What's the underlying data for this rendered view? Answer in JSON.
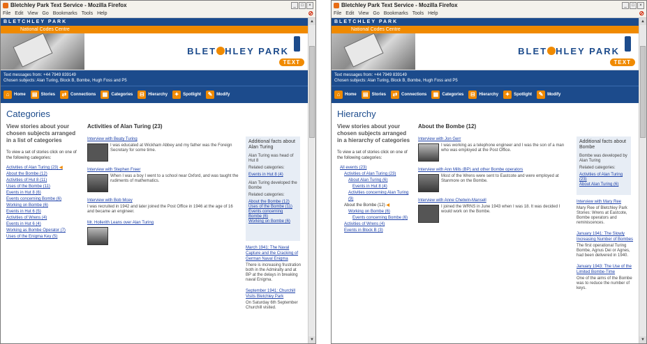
{
  "browser": {
    "title": "Bletchley Park Text Service - Mozilla Firefox",
    "menu": [
      "File",
      "Edit",
      "View",
      "Go",
      "Bookmarks",
      "Tools",
      "Help"
    ]
  },
  "site": {
    "brand": "BLETCHLEY PARK",
    "subbrand": "National Codes Centre",
    "banner_brand_left": "BLET",
    "banner_brand_right": "HLEY PARK",
    "text_tag": "TEXT",
    "info_line1": "Text messages from: +44 7949 839149",
    "info_line2": "Chosen subjects: Alan Turing, Block B, Bombe, Hugh Foss and P5",
    "nav": [
      {
        "label": "Home",
        "icon": "home-icon",
        "glyph": "⌂"
      },
      {
        "label": "Stories",
        "icon": "stories-icon",
        "glyph": "▤"
      },
      {
        "label": "Connections",
        "icon": "connections-icon",
        "glyph": "⇄"
      },
      {
        "label": "Categories",
        "icon": "categories-icon",
        "glyph": "▦"
      },
      {
        "label": "Hierarchy",
        "icon": "hierarchy-icon",
        "glyph": "⊟"
      },
      {
        "label": "Spotlight",
        "icon": "spotlight-icon",
        "glyph": "✦"
      },
      {
        "label": "Modify",
        "icon": "modify-icon",
        "glyph": "✎"
      }
    ]
  },
  "left": {
    "heading": "Categories",
    "lead": "View stories about your chosen subjects arranged in a list of categories",
    "intro": "To view a set of stories click on one of the following categories:",
    "categories": [
      {
        "label": "Activities of Alan Turing (23)",
        "current": true
      },
      {
        "label": "About the Bombe (12)"
      },
      {
        "label": "Activities of Hut 8 (11)"
      },
      {
        "label": "Uses of the Bombe (11)"
      },
      {
        "label": "Events in Hut 8 (6)"
      },
      {
        "label": "Events concerning Bombe (6)"
      },
      {
        "label": "Working on Bombe (6)"
      },
      {
        "label": "Events in Hut 6 (5)"
      },
      {
        "label": "Activities of Wrens (4)"
      },
      {
        "label": "Events in Hut 6 (4)"
      },
      {
        "label": "Working as Bombe Operator (7)"
      },
      {
        "label": "Uses of the Enigma Key (5)"
      }
    ],
    "main_title": "Activities of Alan Turing (23)",
    "stories": [
      {
        "title": "Interview with Beaty Turing",
        "text": "I was educated at Wickham Abbey and my father was the Foreign Secretary for some time."
      },
      {
        "title": "Interview with Stephen Freer",
        "text": "When I was a boy I went to a school near Oxford, and was taught the rudiments of mathematics."
      },
      {
        "title": "Interview with Bob Mcey",
        "text": "I was recruited in 1942 and later joined the Post Office in 1946 at the age of 16 and became an engineer."
      },
      {
        "title": "Mr. Hollerith Leans over Alan Turing",
        "text": ""
      }
    ],
    "facts": {
      "heading": "Additional facts about Alan Turing",
      "lines": [
        "Alan Turing was head of Hut 8",
        "Related categories:"
      ],
      "links": [
        "Events in Hut 8 (4)"
      ],
      "lines2": [
        "Alan Turing developed the Bombe",
        "Related categories:"
      ],
      "links2": [
        "About the Bombe (12)",
        "Uses of the Bombe (11)",
        "Events concerning Bombe (6)",
        "Working on Bombe (6)"
      ]
    },
    "extra": [
      {
        "title": "March 1941: The Naval Capture and the Cracking of German Naval Enigma",
        "text": "There is increasing frustration both in the Admiralty and at BP at the delays in breaking naval Enigma."
      },
      {
        "title": "September 1941: Churchill Visits Bletchley Park",
        "text": "On Saturday 6th September Churchill visited."
      }
    ]
  },
  "right": {
    "heading": "Hierarchy",
    "lead": "View stories about your chosen subjects arranged in a hierarchy of categories",
    "intro": "To view a set of stories click on one of the following categories:",
    "tree": [
      {
        "label": "All events (23)",
        "level": 1
      },
      {
        "label": "Activities of Alan Turing (23)",
        "level": 2
      },
      {
        "label": "About Alan Turing (6)",
        "level": 3
      },
      {
        "label": "Events in Hut 8 (4)",
        "level": 4
      },
      {
        "label": "Activities concerning Alan Turing (9)",
        "level": 3
      },
      {
        "label": "About the Bombe (12)",
        "level": 2,
        "current": true
      },
      {
        "label": "Working on Bombe (6)",
        "level": 3
      },
      {
        "label": "Events concerning Bombe (6)",
        "level": 4
      },
      {
        "label": "Activities of Wrens (4)",
        "level": 2
      },
      {
        "label": "Events in Block B (3)",
        "level": 2
      }
    ],
    "main_title": "About the Bombe (12)",
    "stories": [
      {
        "title": "Interview with Jon Gerr",
        "text": "I was working as a telephone engineer and I was the son of a man who was employed at the Post Office."
      },
      {
        "title": "Interview with Ann Mills (BP) and other Bombe operators",
        "text": "Most of the Wrens were sent to Eastcote and were employed at Stanmore on the Bombe."
      },
      {
        "title": "Interview with Anne Chetwin-Mansell",
        "text": "I joined the WRNS in June 1943 when I was 18. It was decided I would work on the Bombe."
      }
    ],
    "facts": {
      "heading": "Additional facts about Bombe",
      "lines": [
        "Bombe was developed by Alan Turing",
        "Related categories:"
      ],
      "links": [
        "Activities of Alan Turing (23)",
        "About Alan Turing (6)"
      ]
    },
    "extra": [
      {
        "title": "Interview with Mary Ree",
        "text": "Mary Ree of Bletchley Park Stories: Wrens at Eastcote, Bombe operators and reminiscences."
      },
      {
        "title": "January 1941: The Slowly Increasing Number of Bombes",
        "text": "The first operational Turing Bombe, Agnus Dei or Agnes, had been delivered in 1940."
      },
      {
        "title": "January 1943: The Use of the Limited Bombe-Time",
        "text": "One of the aims of the Bombe was to reduce the number of keys."
      }
    ]
  }
}
